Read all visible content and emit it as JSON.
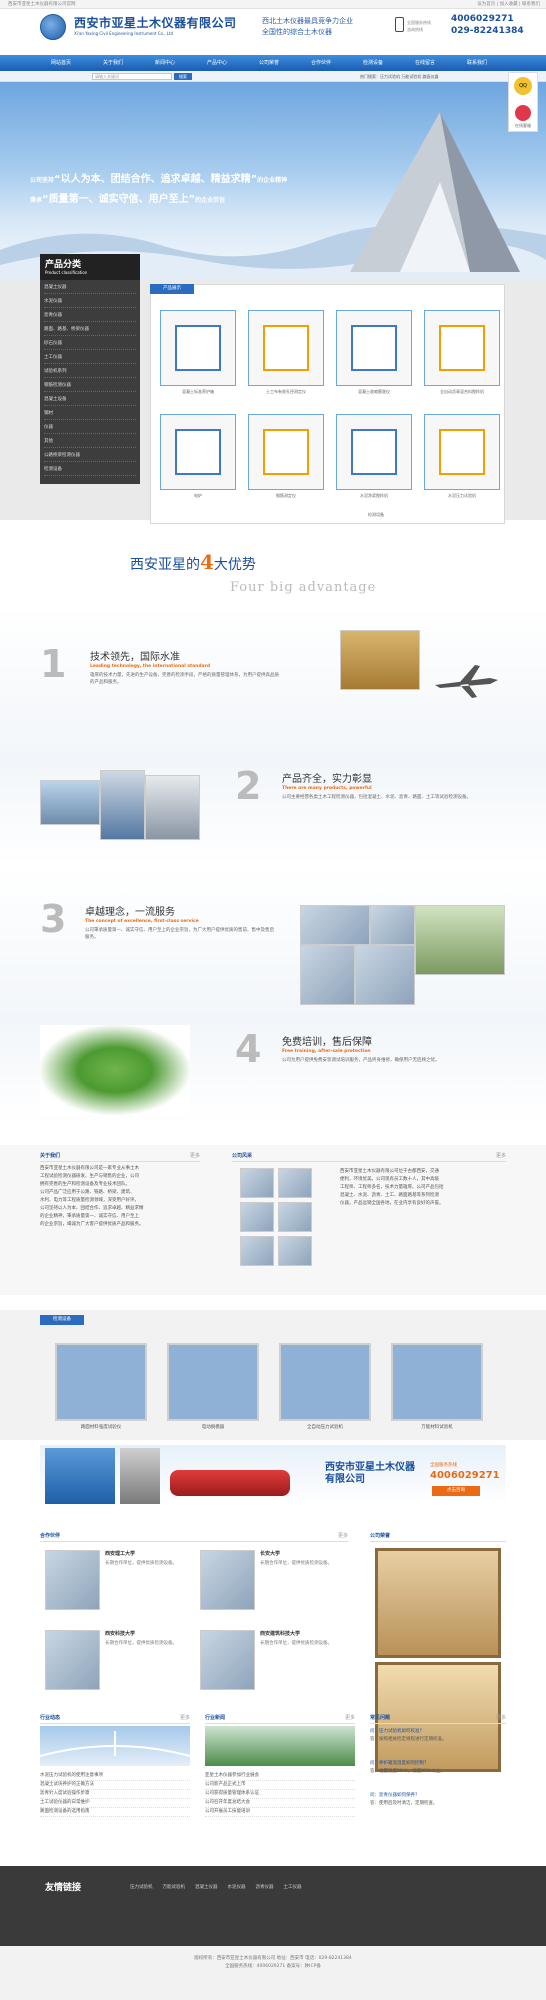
{
  "topbar": {
    "left": "西安市亚星土木仪器有限公司官网",
    "right": "设为首页 | 加入收藏 | 联系我们"
  },
  "header": {
    "company_cn": "西安市亚星土木仪器有限公司",
    "company_en": "Xi'an Yaxing Civil Engineering Instrument Co., Ltd",
    "slogan_l1": "西北土木仪器最具竞争力企业",
    "slogan_l2": "全国性的综合土木仪器",
    "phone_label1": "全国服务热线",
    "phone_label2": "咨询热线",
    "phone1": "4006029271",
    "phone2": "029-82241384"
  },
  "nav": [
    "网站首页",
    "关于我们",
    "新闻中心",
    "产品中心",
    "公司荣誉",
    "合作伙伴",
    "检测设备",
    "在线留言",
    "联系我们"
  ],
  "search": {
    "placeholder": "请输入关键词",
    "button": "搜索"
  },
  "ticker": "热门搜索：压力试验机 万能试验机 路面仪器",
  "banner": {
    "l1_pre": "公司坚持",
    "l1_quote": "“以人为本、团结合作、追求卓越、精益求精”",
    "l1_post": "的企业精神",
    "l2_pre": "秉承",
    "l2_quote": "“质量第一、诚实守信、用户至上”",
    "l2_post": "的企业宗旨"
  },
  "side": {
    "qq": "QQ",
    "label": "在线客服"
  },
  "products": {
    "cat_title": "产品分类",
    "cat_en": "Product classification",
    "cats": [
      "混凝土仪器",
      "水泥仪器",
      "沥青仪器",
      "路面、路基、桥梁仪器",
      "砂石仪器",
      "土工仪器",
      "试验机系列",
      "钢筋检测仪器",
      "混凝土设备",
      "钢材",
      "仪器",
      "其他",
      "公路桥梁检测仪器",
      "检测设备"
    ],
    "tab": "产品展示",
    "items": [
      "混凝土标准养护箱",
      "土工布有效孔径测定仪",
      "混凝土收缩膨胀仪",
      "全自动沥青混合料搅拌机",
      "电炉",
      "钢筋测定仪",
      "水泥净浆搅拌机",
      "水泥压力试验机"
    ],
    "more_caption": "检测设备"
  },
  "advantages": {
    "title_pre": "西安亚星的",
    "title_num": "4",
    "title_post": "大优势",
    "title_en": "Four big advantage",
    "items": [
      {
        "num": "1",
        "h": "技术领先，国际水准",
        "s": "Leading technology, the international standard",
        "p": "雄厚的技术力量，先进的生产设备，完善的检测手段，严格的质量管理体系，为用户提供高品质的产品和服务。"
      },
      {
        "num": "2",
        "h": "产品齐全，实力彰显",
        "s": "There are many products, powerful",
        "p": "公司主要经营各类土木工程检测仪器，包括混凝土、水泥、沥青、路面、土工等试验检测设备。"
      },
      {
        "num": "3",
        "h": "卓越理念，一流服务",
        "s": "The concept of excellence, first-class service",
        "p": "公司秉承质量第一、诚实守信、用户至上的企业宗旨，为广大用户提供优质的售前、售中及售后服务。"
      },
      {
        "num": "4",
        "h": "免费培训，售后保障",
        "s": "Free training, after-sale protection",
        "p": "公司为用户提供免费安装调试培训服务，产品终身维修，确保用户无后顾之忧。"
      }
    ]
  },
  "about": {
    "title": "关于我们",
    "more": "更多",
    "lines": [
      "西安市亚星土木仪器有限公司是一家专业从事土木",
      "工程试验检测仪器研发、生产与销售的企业，公司",
      "拥有完善的生产和检测设备及专业技术团队。",
      "公司产品广泛应用于公路、铁路、桥梁、建筑、",
      "水利、电力等工程质量检测领域，深受用户好评。",
      "公司坚持以人为本、团结合作、追求卓越、精益求精",
      "的企业精神，秉承质量第一、诚实守信、用户至上",
      "的企业宗旨，竭诚为广大客户提供优质产品和服务。"
    ]
  },
  "company_photos": {
    "title": "公司风采",
    "more": "更多",
    "text_lines": [
      "西安市亚星土木仪器有限公司位于古都西安，交通",
      "便利，环境优美。公司现有员工数十人，其中高级",
      "工程师、工程师多名，技术力量雄厚。公司产品包括",
      "混凝土、水泥、沥青、土工、路面路基等系列检测",
      "仪器，产品远销全国各地，在业内享有良好的声誉。"
    ]
  },
  "cases": {
    "title": "检测设备",
    "items": [
      "路面材料强度试验仪",
      "电动脱模器",
      "全自动压力试验机",
      "万能材料试验机"
    ]
  },
  "promo": {
    "company": "西安市亚星土木仪器",
    "company2": "有限公司",
    "hotline_label": "全国服务热线",
    "hotline": "4006029271",
    "btn": "点击咨询"
  },
  "partners": {
    "title": "合作伙伴",
    "more": "更多",
    "items": [
      {
        "name": "西安理工大学",
        "desc": "长期合作单位，提供优质检测设备。"
      },
      {
        "name": "长安大学",
        "desc": "长期合作单位，提供优质检测设备。"
      },
      {
        "name": "西安科技大学",
        "desc": "长期合作单位，提供优质检测设备。"
      },
      {
        "name": "西安建筑科技大学",
        "desc": "长期合作单位，提供优质检测设备。"
      }
    ]
  },
  "honors": {
    "title": "公司荣誉"
  },
  "news_industry": {
    "title": "行业动态",
    "more": "更多",
    "items": [
      "水泥压力试验机的使用注意事项",
      "混凝土试块养护的正确方法",
      "沥青针入度试验操作步骤",
      "土工试验仪器的日常维护",
      "路面检测设备的选用指南"
    ]
  },
  "news_company": {
    "title": "行业新闻",
    "more": "更多",
    "items": [
      "亚星土木仪器参加行业展会",
      "公司新产品正式上市",
      "公司获得质量管理体系认证",
      "公司召开年度总结大会",
      "公司开展员工技能培训"
    ]
  },
  "faq": {
    "title": "常见问题",
    "more": "更多",
    "items": [
      {
        "q": "问：压力试验机如何校准？",
        "a": "答：按照相关检定规程进行定期校准。"
      },
      {
        "q": "问：养护箱温湿度如何控制？",
        "a": "答：设置温度20℃，湿度95%以上。"
      },
      {
        "q": "问：沥青仪器如何保养？",
        "a": "答：使用后及时清洁，定期检查。"
      }
    ]
  },
  "friend_links": {
    "title": "友情链接",
    "items": [
      "压力试验机",
      "万能试验机",
      "混凝土仪器",
      "水泥仪器",
      "沥青仪器",
      "土工仪器"
    ]
  },
  "footer": {
    "lines": [
      "版权所有：西安市亚星土木仪器有限公司 地址：西安市 电话：029-82241384",
      "全国服务热线：4006029271 备案号：陕ICP备"
    ]
  },
  "colors": {
    "brand": "#1a4f9c",
    "accent": "#e96b14",
    "nav": "#2c6cc0"
  }
}
